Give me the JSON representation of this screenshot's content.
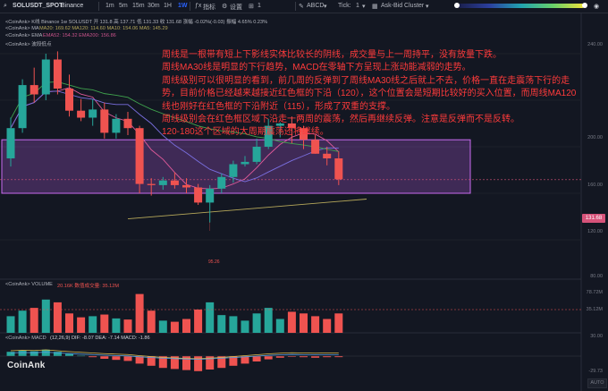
{
  "topbar": {
    "symbol": "SOLUSDT_SPOT",
    "exchange": "Binance",
    "intervals": [
      "1m",
      "5m",
      "15m",
      "30m",
      "1H",
      "1W"
    ],
    "active_interval": "1W",
    "indicators_label": "指标",
    "settings_label": "设置",
    "layout_count": "1",
    "abcd_label": "ABCD",
    "tick_label": "Tick:",
    "tick_value": "1",
    "cluster_label": "Ask-Bid Cluster"
  },
  "legends": {
    "main": "<CoinAnk> K线  Binance 1w SOLUSDT  开 131.8  高 137.71  低 131.33  收 131.68  涨幅 -0.02%(-0.03)  振幅 4.65%  0.23%",
    "ma": "<CoinAnk> MA",
    "ma_values": "MA20: 169.62  MA120: 114.60  MA10: 154.06  MA5: 145.29",
    "ema": "<CoinAnk> EMA",
    "ema_values": "EMA52: 154.32  EMA200: 156.86",
    "waves": "<CoinAnk> 波段低点",
    "volume": "<CoinAnk> VOLUME",
    "volume_values": "20.16K  数值成交量: 35.12M",
    "macd": "<CoinAnk> MACD",
    "macd_values": "(12,26,9)  DIF: -8.07  DEA: -7.14  MACD: -1.86"
  },
  "price_axis": [
    "240.00",
    "200.00",
    "160.00",
    "120.00",
    "80.00"
  ],
  "volume_axis": [
    "78.72M",
    "35.12M"
  ],
  "macd_axis": [
    "30.00",
    "-29.73"
  ],
  "current_price": "131.68",
  "low_marker": "95.26",
  "annotation_lines": [
    "周线是一根带有短上下影线实体比较长的阴线，成交量与上一周持平，没有放量下跌。",
    "周线MA30线是明显的下行趋势，MACD在零轴下方呈现上涨动能减弱的走势。",
    "周线级别可以很明显的看到，前几周的反弹到了周线MA30线之后就上不去，价格一直在走震荡下行的走",
    "势，目前价格已经越来越接近红色框的下沿（120），这个位置会是短期比较好的买入位置，而周线MA120",
    "线也刚好在红色框的下沿附近（115），形成了双重的支撑。",
    "周线级别会在红色框区域下沿走一两周的震荡，然后再继续反弹。注意是反弹而不是反转。",
    "120-180这个区域的大周期震荡还将继续。"
  ],
  "logo": "CoinAnk",
  "auto_label": "AUTO",
  "colors": {
    "up": "#26a69a",
    "down": "#ef5350",
    "box": "#b25ee0",
    "annotation": "#ff3b3b"
  },
  "candles": [
    {
      "o": 150,
      "h": 185,
      "l": 143,
      "c": 176
    },
    {
      "o": 176,
      "h": 218,
      "l": 172,
      "c": 213
    },
    {
      "o": 213,
      "h": 228,
      "l": 198,
      "c": 205
    },
    {
      "o": 205,
      "h": 240,
      "l": 200,
      "c": 235
    },
    {
      "o": 235,
      "h": 242,
      "l": 205,
      "c": 210
    },
    {
      "o": 210,
      "h": 222,
      "l": 186,
      "c": 191
    },
    {
      "o": 191,
      "h": 201,
      "l": 182,
      "c": 185
    },
    {
      "o": 185,
      "h": 201,
      "l": 178,
      "c": 192
    },
    {
      "o": 192,
      "h": 198,
      "l": 167,
      "c": 172
    },
    {
      "o": 172,
      "h": 188,
      "l": 167,
      "c": 184
    },
    {
      "o": 184,
      "h": 190,
      "l": 170,
      "c": 176
    },
    {
      "o": 176,
      "h": 178,
      "l": 120,
      "c": 128
    },
    {
      "o": 128,
      "h": 133,
      "l": 118,
      "c": 127
    },
    {
      "o": 127,
      "h": 134,
      "l": 123,
      "c": 131
    },
    {
      "o": 131,
      "h": 138,
      "l": 124,
      "c": 127
    },
    {
      "o": 127,
      "h": 133,
      "l": 120,
      "c": 125
    },
    {
      "o": 125,
      "h": 128,
      "l": 110,
      "c": 112
    },
    {
      "o": 112,
      "h": 127,
      "l": 95,
      "c": 124
    },
    {
      "o": 124,
      "h": 137,
      "l": 120,
      "c": 134
    },
    {
      "o": 134,
      "h": 148,
      "l": 129,
      "c": 145
    },
    {
      "o": 145,
      "h": 152,
      "l": 143,
      "c": 147
    },
    {
      "o": 147,
      "h": 167,
      "l": 145,
      "c": 160
    },
    {
      "o": 160,
      "h": 184,
      "l": 158,
      "c": 178
    },
    {
      "o": 178,
      "h": 181,
      "l": 168,
      "c": 180
    },
    {
      "o": 180,
      "h": 186,
      "l": 163,
      "c": 176
    },
    {
      "o": 176,
      "h": 178,
      "l": 158,
      "c": 166
    },
    {
      "o": 166,
      "h": 170,
      "l": 154,
      "c": 154
    },
    {
      "o": 154,
      "h": 160,
      "l": 144,
      "c": 150
    },
    {
      "o": 150,
      "h": 156,
      "l": 127,
      "c": 132
    }
  ],
  "volumes": [
    {
      "v": 30,
      "up": true
    },
    {
      "v": 40,
      "up": true
    },
    {
      "v": 45,
      "up": false
    },
    {
      "v": 60,
      "up": true
    },
    {
      "v": 55,
      "up": false
    },
    {
      "v": 35,
      "up": false
    },
    {
      "v": 28,
      "up": false
    },
    {
      "v": 30,
      "up": true
    },
    {
      "v": 33,
      "up": false
    },
    {
      "v": 26,
      "up": true
    },
    {
      "v": 24,
      "up": false
    },
    {
      "v": 70,
      "up": false
    },
    {
      "v": 40,
      "up": false
    },
    {
      "v": 22,
      "up": true
    },
    {
      "v": 20,
      "up": false
    },
    {
      "v": 25,
      "up": false
    },
    {
      "v": 42,
      "up": false
    },
    {
      "v": 55,
      "up": true
    },
    {
      "v": 32,
      "up": true
    },
    {
      "v": 30,
      "up": true
    },
    {
      "v": 22,
      "up": true
    },
    {
      "v": 35,
      "up": true
    },
    {
      "v": 45,
      "up": true
    },
    {
      "v": 25,
      "up": true
    },
    {
      "v": 38,
      "up": false
    },
    {
      "v": 35,
      "up": false
    },
    {
      "v": 30,
      "up": false
    },
    {
      "v": 25,
      "up": false
    },
    {
      "v": 35,
      "up": false
    }
  ],
  "macd_hist": [
    8,
    10,
    9,
    12,
    8,
    4,
    1,
    -2,
    -5,
    -7,
    -9,
    -14,
    -18,
    -22,
    -24,
    -26,
    -28,
    -25,
    -22,
    -18,
    -14,
    -10,
    -6,
    -3,
    -1,
    -2,
    -3,
    -2,
    -1.9
  ]
}
